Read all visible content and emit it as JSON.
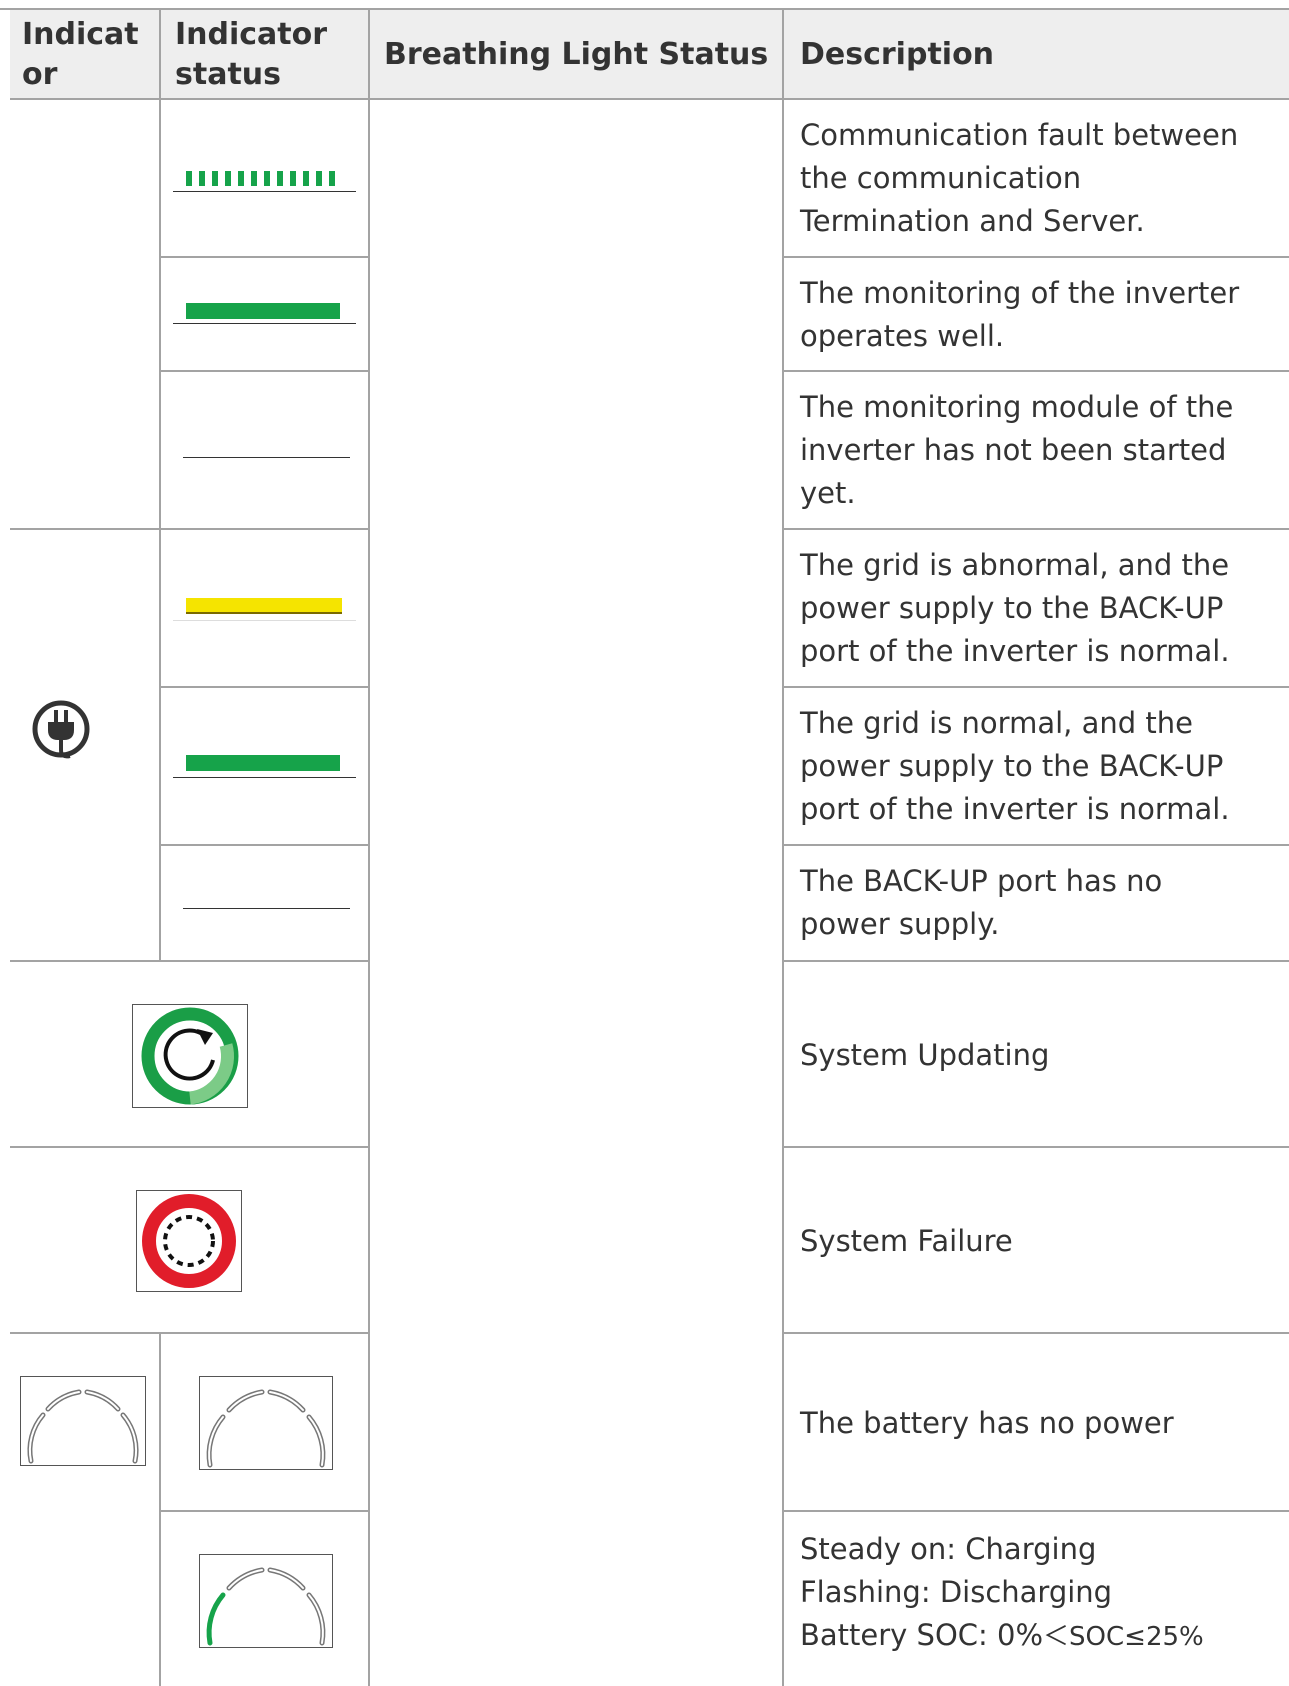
{
  "header": {
    "col1": "Indicat or",
    "col1_line1": "Indicat",
    "col1_line2": "or",
    "col2_line1": "Indicator",
    "col2_line2": "status",
    "col3": "Breathing Light Status",
    "col4": "Description"
  },
  "rows": [
    {
      "status": "dashed-green-flashing",
      "description": [
        "Communication fault between",
        "the communication",
        "Termination and Server."
      ]
    },
    {
      "status": "green-steady",
      "description": [
        "The monitoring of the inverter",
        "operates well."
      ]
    },
    {
      "status": "off",
      "description": [
        "The monitoring module of the",
        "inverter has not been started",
        "yet."
      ]
    },
    {
      "status": "yellow-steady",
      "description": [
        "The grid is abnormal, and the",
        "power supply to the BACK-UP",
        "port of the inverter is normal."
      ]
    },
    {
      "status": "green-steady",
      "description": [
        "The grid is normal, and the",
        "power supply to the BACK-UP",
        "port of the inverter is normal."
      ]
    },
    {
      "status": "off",
      "description": [
        "The BACK-UP port has no",
        "power supply."
      ]
    },
    {
      "status": "update-icon",
      "description": [
        "System Updating"
      ]
    },
    {
      "status": "failure-icon",
      "description": [
        "System Failure"
      ]
    },
    {
      "status": "battery-empty",
      "description": [
        "The battery has no power"
      ]
    },
    {
      "status": "battery-low",
      "description": [
        "Steady on: Charging",
        "Flashing: Discharging"
      ],
      "soc_prefix": "Battery SOC: 0%",
      "soc_suffix": "＜SOC≤25%"
    }
  ],
  "colors": {
    "green": "#16a34a",
    "yellow": "#f5e400",
    "red": "#e11d2a",
    "border": "#a3a3a3",
    "header_bg": "#eeeeee"
  },
  "icons": {
    "grid": "plug-icon",
    "update": "refresh-icon",
    "failure": "failure-ring-icon",
    "battery": "battery-arc-icon"
  }
}
